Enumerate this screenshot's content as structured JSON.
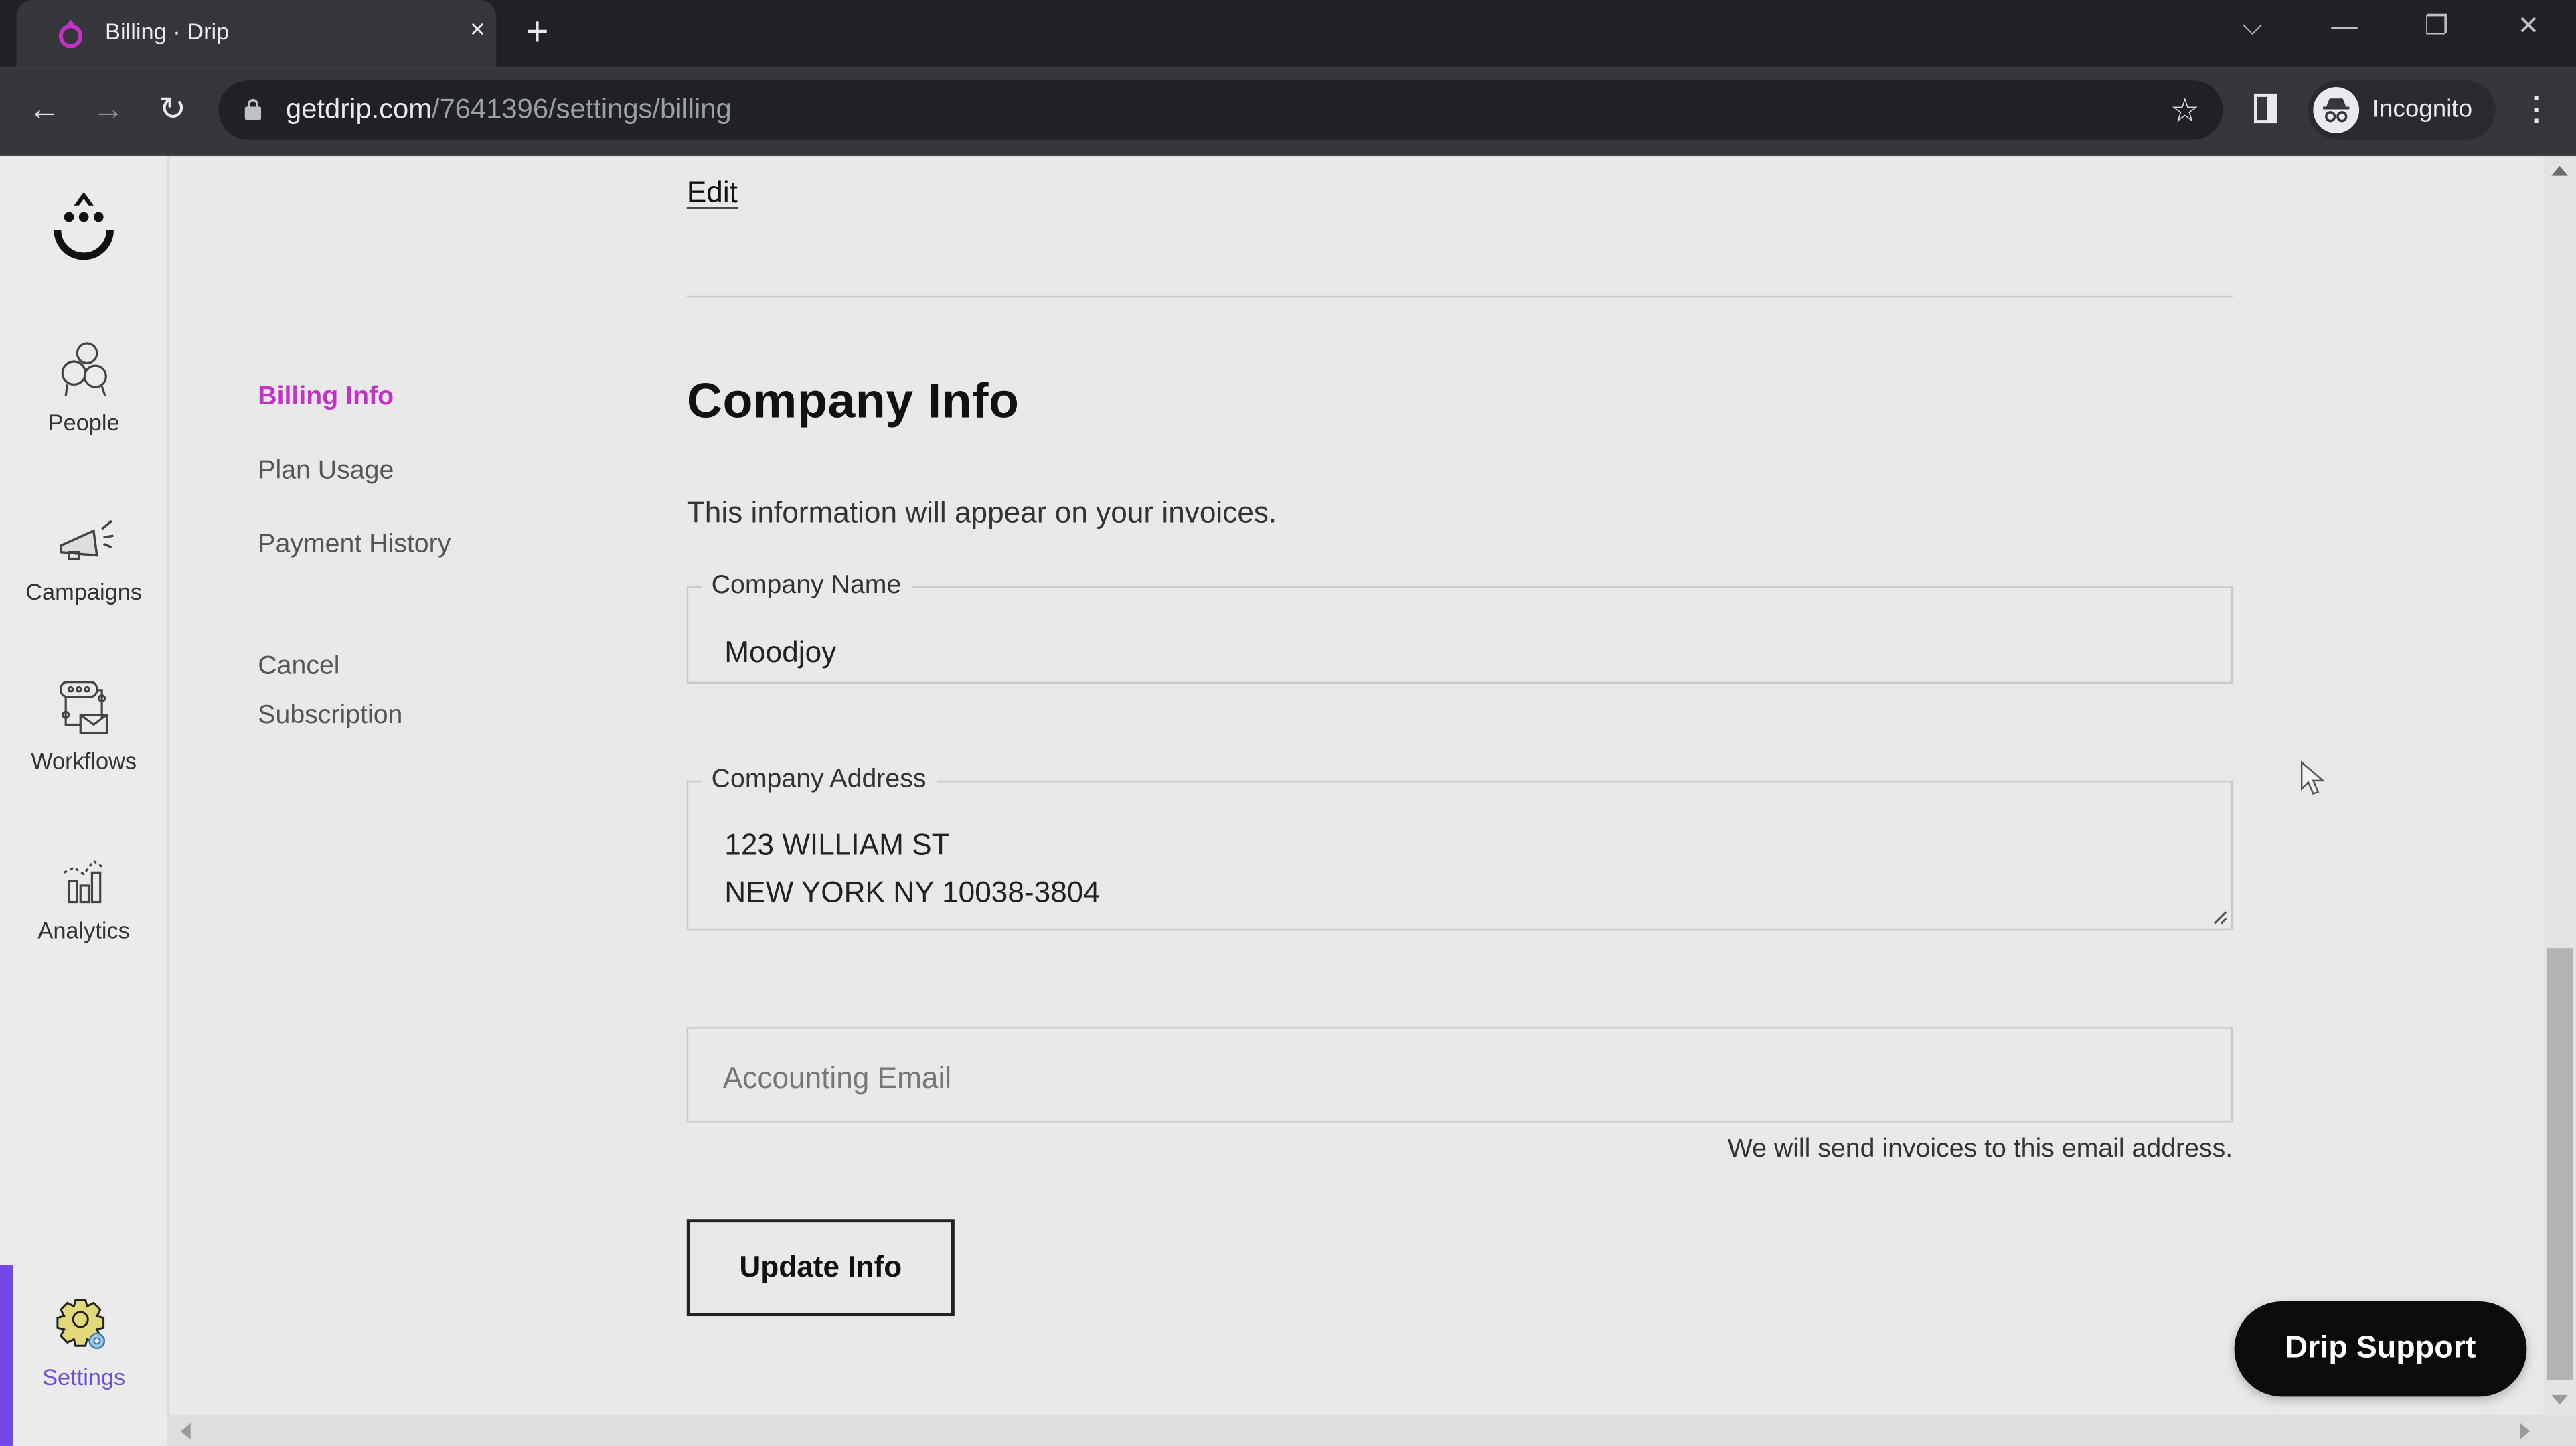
{
  "browser": {
    "tab_title": "Billing · Drip",
    "tab_close": "×",
    "new_tab": "+",
    "url_host": "getdrip.com",
    "url_path": "/7641396/settings/billing",
    "profile_label": "Incognito",
    "window_controls": {
      "tab_search": "⌵",
      "minimize": "—",
      "restore": "❐",
      "close": "✕"
    },
    "nav": {
      "back": "←",
      "forward": "→",
      "reload": "↻"
    },
    "star": "☆",
    "menu": "⋮"
  },
  "sidebar": {
    "items": [
      {
        "label": "People",
        "icon": "people-icon"
      },
      {
        "label": "Campaigns",
        "icon": "megaphone-icon"
      },
      {
        "label": "Workflows",
        "icon": "workflow-icon"
      },
      {
        "label": "Analytics",
        "icon": "analytics-icon"
      },
      {
        "label": "Settings",
        "icon": "gear-icon",
        "active": true
      }
    ],
    "accent_color": "#7547e8"
  },
  "subnav": {
    "items": [
      {
        "label": "Billing Info",
        "active": true
      },
      {
        "label": "Plan Usage"
      },
      {
        "label": "Payment History"
      },
      {
        "label": "Cancel Subscription"
      }
    ],
    "active_color": "#c530c9"
  },
  "main": {
    "edit_link": "Edit",
    "title": "Company Info",
    "intro": "This information will appear on your invoices.",
    "company_name": {
      "label": "Company Name",
      "value": "Moodjoy"
    },
    "company_address": {
      "label": "Company Address",
      "value": "123 WILLIAM ST\nNEW YORK NY 10038-3804"
    },
    "accounting_email": {
      "placeholder": "Accounting Email",
      "value": ""
    },
    "email_hint": "We will send invoices to this email address.",
    "update_button": "Update Info"
  },
  "support_button": "Drip Support"
}
